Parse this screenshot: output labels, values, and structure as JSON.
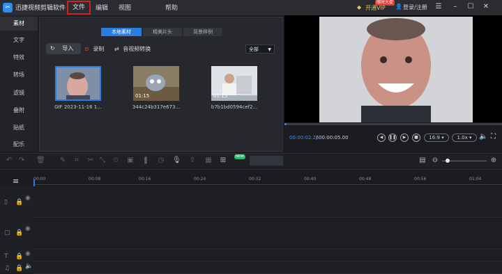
{
  "titlebar": {
    "app_title": "迅捷视频剪辑软件",
    "menu": [
      "文件",
      "编辑",
      "视图",
      "帮助"
    ],
    "vip_badge": "限时大促",
    "vip_label": "开通VIP",
    "login_label": "登录/注册",
    "window_buttons": [
      "min-icon",
      "restore-icon",
      "maximize-icon",
      "close-icon"
    ]
  },
  "sidebar": {
    "items": [
      "素材",
      "文字",
      "特效",
      "转场",
      "滤镜",
      "叠附",
      "贴纸",
      "配乐"
    ],
    "active_index": 0
  },
  "media": {
    "tabs": [
      "本地素材",
      "精美片头",
      "背景样例"
    ],
    "import_label": "导入",
    "record_label": "录制",
    "convert_label": "音视频转换",
    "filter_value": "全部",
    "items": [
      {
        "label": "GIF 2023-11-16 1...",
        "duration": ""
      },
      {
        "label": "344c24b317e673...",
        "duration": "01:15"
      },
      {
        "label": "b7b1bd0594cef2...",
        "duration": "01:15"
      }
    ]
  },
  "preview": {
    "current_time": "00:00:02.25",
    "separator": " / ",
    "total_time": "00:00:05.00",
    "aspect": "16:9",
    "speed": "1.0x",
    "progress_fraction": 0.01
  },
  "timeline": {
    "ruler_labels": [
      "00:00",
      "00:08",
      "00:16",
      "00:24",
      "00:32",
      "00:40",
      "00:48",
      "00:56",
      "01:04"
    ],
    "new_badge": "NEW"
  },
  "colors": {
    "accent": "#2a7de1",
    "highlight_border": "#d42020",
    "vip_gold": "#e6c15a"
  }
}
